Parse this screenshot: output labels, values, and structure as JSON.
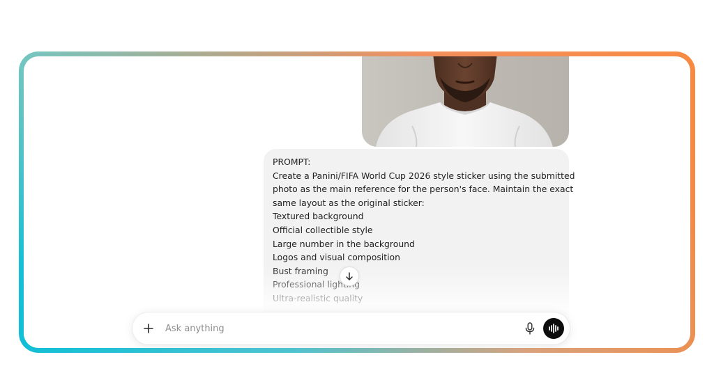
{
  "message": {
    "lines": [
      "PROMPT:",
      "Create a Panini/FIFA World Cup 2026 style sticker using the submitted",
      "photo as the main reference for the person's face. Maintain the exact",
      "same layout as the original sticker:",
      "Textured background",
      "Official collectible style",
      "Large number in the background",
      "Logos and visual composition",
      "Bust framing",
      "Professional lighting",
      "Ultra-realistic quality"
    ]
  },
  "composer": {
    "placeholder": "Ask anything",
    "add_icon": "plus-icon",
    "mic_icon": "microphone-icon",
    "voice_icon": "voice-mode-icon"
  },
  "scroll_icon": "arrow-down-icon",
  "colors": {
    "frame_start": "#74c7c2",
    "frame_orange": "#f88a3e",
    "frame_cyan": "#10bfd6",
    "bubble": "#f2f2f2",
    "voice_button": "#0d0d0d"
  }
}
